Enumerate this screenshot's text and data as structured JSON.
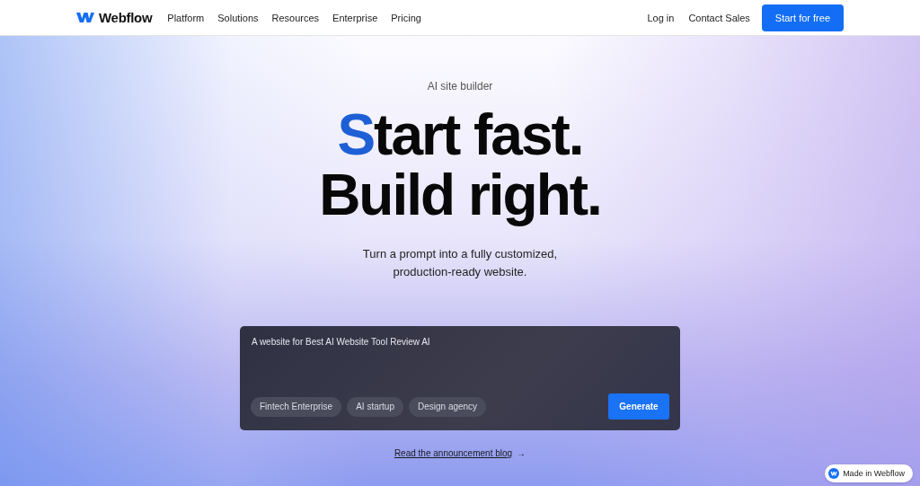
{
  "nav": {
    "brand": "Webflow",
    "links": [
      "Platform",
      "Solutions",
      "Resources",
      "Enterprise",
      "Pricing"
    ],
    "right_links": [
      "Log in",
      "Contact Sales"
    ],
    "cta": "Start for free"
  },
  "hero": {
    "eyebrow": "AI site builder",
    "headline": [
      "Start fast.",
      "Build right."
    ],
    "subtitle": "Turn a prompt into a fully customized, production-ready website.",
    "prompt": {
      "value": "A website for Best AI Website Tool Review AI",
      "suggestions": [
        "Fintech Enterprise",
        "AI startup",
        "Design agency"
      ],
      "button": "Generate"
    },
    "link": "Read the announcement blog",
    "link_arrow": "→"
  },
  "badge": "Made in Webflow"
}
